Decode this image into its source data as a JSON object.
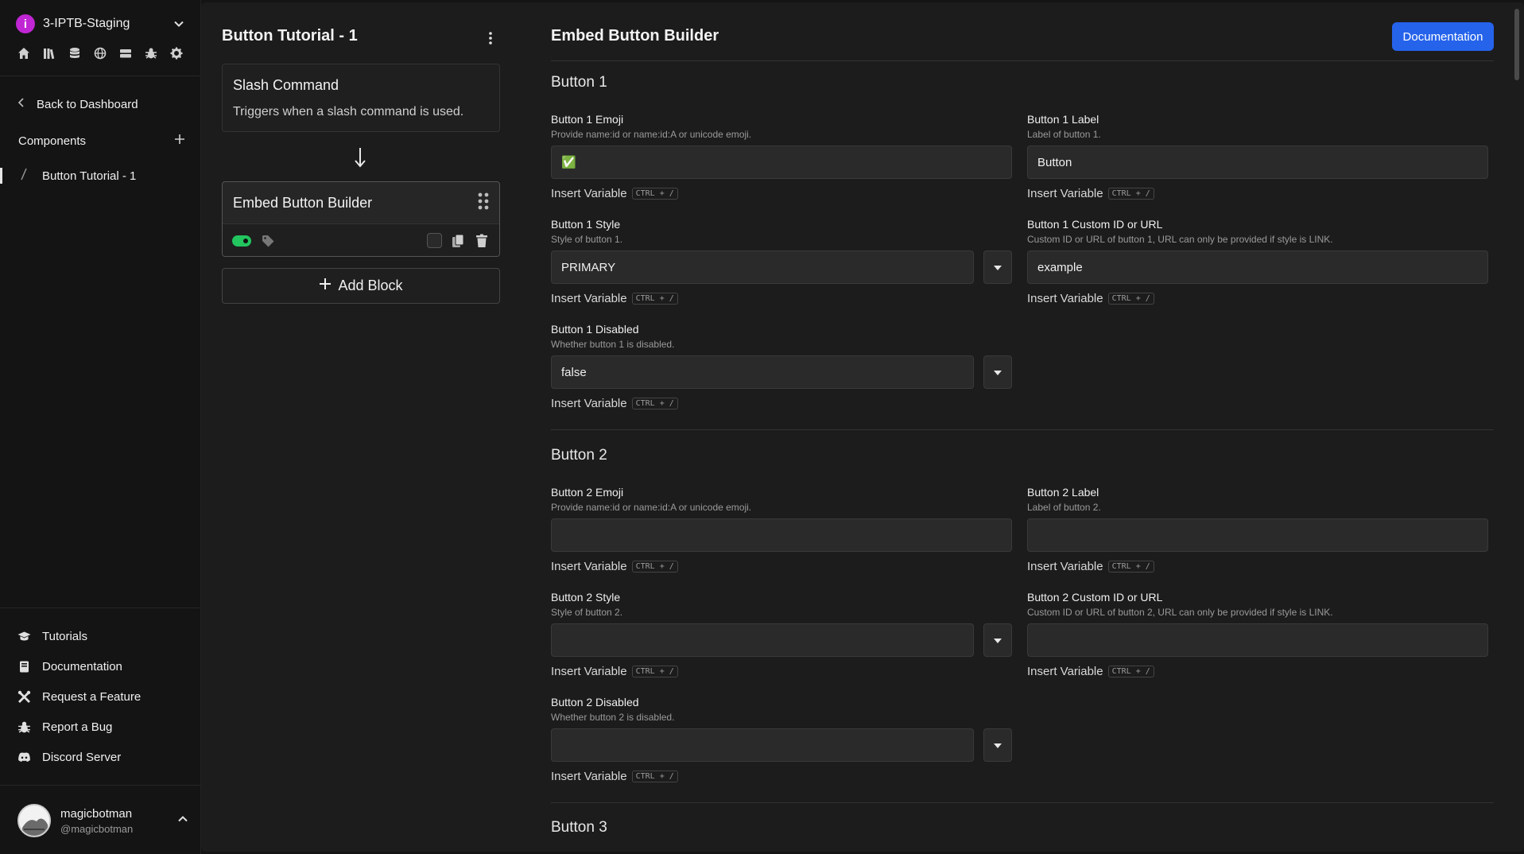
{
  "sidebar": {
    "server_name": "3-IPTB-Staging",
    "server_logo_glyph": "i",
    "server_logo_color": "#c026d3",
    "top_icons": [
      "home-icon",
      "library-icon",
      "database-icon",
      "globe-icon",
      "storage-icon",
      "bug-icon",
      "gear-icon"
    ],
    "back_label": "Back to Dashboard",
    "components_label": "Components",
    "component_items": [
      {
        "label": "Button Tutorial - 1"
      }
    ],
    "bottom_nav": [
      {
        "label": "Tutorials",
        "icon": "graduation-cap-icon"
      },
      {
        "label": "Documentation",
        "icon": "book-icon"
      },
      {
        "label": "Request a Feature",
        "icon": "tools-icon"
      },
      {
        "label": "Report a Bug",
        "icon": "bug-icon"
      },
      {
        "label": "Discord Server",
        "icon": "discord-icon"
      }
    ],
    "user": {
      "name": "magicbotman",
      "handle": "@magicbotman"
    }
  },
  "middle": {
    "title": "Button Tutorial - 1",
    "trigger": {
      "title": "Slash Command",
      "subtitle": "Triggers when a slash command is used."
    },
    "block": {
      "title": "Embed Button Builder",
      "enabled": true
    },
    "add_block_label": "Add Block"
  },
  "form": {
    "title": "Embed Button Builder",
    "doc_button": "Documentation",
    "accent": "#2563eb",
    "insert_variable": "Insert Variable",
    "shortcut": "CTRL + /",
    "sections": [
      {
        "title": "Button 1",
        "emoji": {
          "label": "Button 1 Emoji",
          "desc": "Provide name:id or name:id:A or unicode emoji.",
          "value": "✅"
        },
        "label": {
          "label": "Button 1 Label",
          "desc": "Label of button 1.",
          "value": "Button"
        },
        "style": {
          "label": "Button 1 Style",
          "desc": "Style of button 1.",
          "value": "PRIMARY"
        },
        "custom": {
          "label": "Button 1 Custom ID or URL",
          "desc": "Custom ID or URL of button 1, URL can only be provided if style is LINK.",
          "value": "example"
        },
        "disabled": {
          "label": "Button 1 Disabled",
          "desc": "Whether button 1 is disabled.",
          "value": "false"
        }
      },
      {
        "title": "Button 2",
        "emoji": {
          "label": "Button 2 Emoji",
          "desc": "Provide name:id or name:id:A or unicode emoji.",
          "value": ""
        },
        "label": {
          "label": "Button 2 Label",
          "desc": "Label of button 2.",
          "value": ""
        },
        "style": {
          "label": "Button 2 Style",
          "desc": "Style of button 2.",
          "value": ""
        },
        "custom": {
          "label": "Button 2 Custom ID or URL",
          "desc": "Custom ID or URL of button 2, URL can only be provided if style is LINK.",
          "value": ""
        },
        "disabled": {
          "label": "Button 2 Disabled",
          "desc": "Whether button 2 is disabled.",
          "value": ""
        }
      },
      {
        "title": "Button 3"
      }
    ]
  }
}
